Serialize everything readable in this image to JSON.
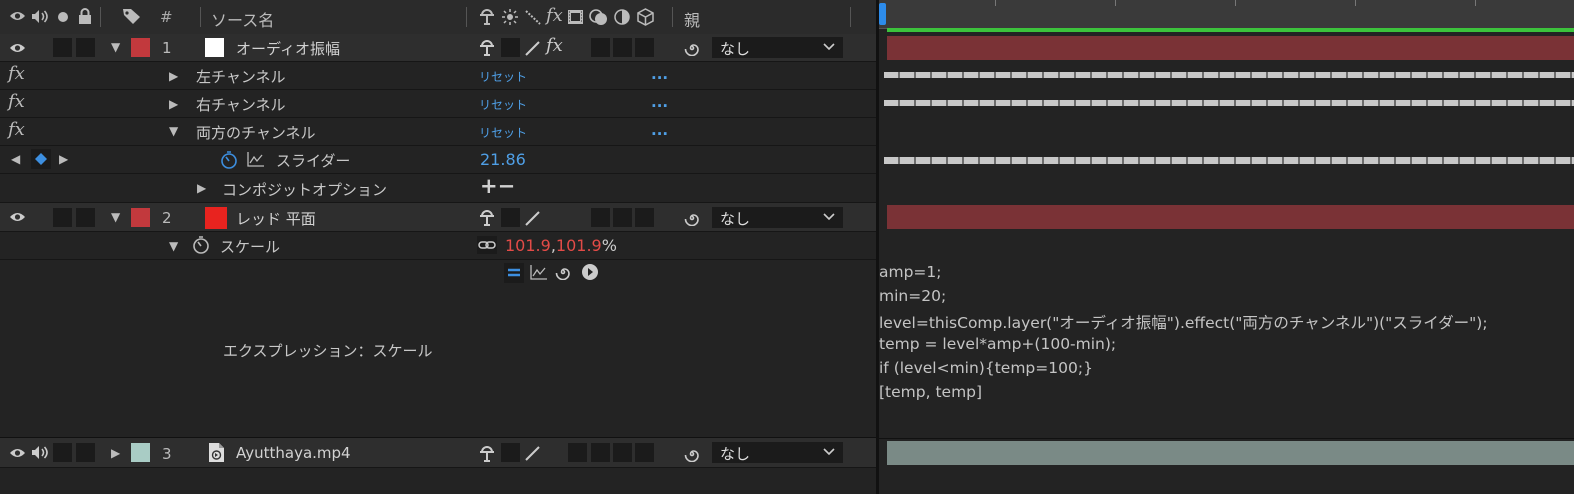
{
  "header": {
    "tag_col": "#",
    "source_name_col": "ソース名",
    "parent_col": "親"
  },
  "layers": [
    {
      "number": "1",
      "name": "オーディオ振幅",
      "label_color": "#c2393d",
      "swatch_color": "#ffffff",
      "parent": "なし",
      "bar_color": "#7a3236"
    },
    {
      "number": "2",
      "name": "レッド 平面",
      "label_color": "#c2393d",
      "swatch_color": "#e8231f",
      "parent": "なし",
      "bar_color": "#7a3236"
    },
    {
      "number": "3",
      "name": "Ayutthaya.mp4",
      "label_color": "#a9ccc5",
      "swatch_color": "#a9ccc5",
      "parent": "なし",
      "bar_color": "#7a8a86"
    }
  ],
  "effects": [
    {
      "fx": "fx",
      "name": "左チャンネル",
      "reset": "リセット",
      "more": "..."
    },
    {
      "fx": "fx",
      "name": "右チャンネル",
      "reset": "リセット",
      "more": "..."
    },
    {
      "fx": "fx",
      "name": "両方のチャンネル",
      "reset": "リセット",
      "more": "..."
    }
  ],
  "slider": {
    "name": "スライダー",
    "value": "21.86"
  },
  "composite": {
    "name": "コンポジットオプション",
    "ops": "+−"
  },
  "scale": {
    "name": "スケール",
    "value_x": "101.9",
    "comma": ",",
    "value_y": "101.9",
    "unit": "%"
  },
  "expression": {
    "label": "エクスプレッション：スケール",
    "lines": [
      "amp=1;",
      "min=20;",
      "level=thisComp.layer(\"オーディオ振幅\").effect(\"両方のチャンネル\")(\"スライダー\");",
      "temp = level*amp+(100-min);",
      "if (level<min){temp=100;}",
      "[temp, temp]"
    ]
  },
  "colors": {
    "accent_blue": "#4f9fe6",
    "value_red": "#e24b47",
    "work_area_green": "#3cc23c",
    "current_time_indicator": "#2d8ceb"
  }
}
